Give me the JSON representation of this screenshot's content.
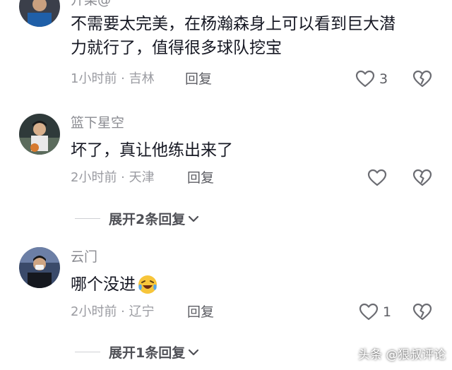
{
  "comments": [
    {
      "username": "开菜@",
      "text_lines": [
        "不需要太完美，在杨瀚森身上可以看到巨大潜",
        "力就行了，值得很多球队挖宝"
      ],
      "time": "1小时前 · 吉林",
      "reply_label": "回复",
      "like_count": "3"
    },
    {
      "username": "篮下星空",
      "text_lines": [
        "坏了，真让他练出来了"
      ],
      "time": "2小时前 · 天津",
      "reply_label": "回复",
      "like_count": ""
    },
    {
      "username": "云门",
      "text_lines": [
        "哪个没进"
      ],
      "emoji": "laughing-crying-emoji",
      "time": "2小时前 · 辽宁",
      "reply_label": "回复",
      "like_count": "1"
    }
  ],
  "expand_links": [
    "展开2条回复",
    "展开1条回复"
  ],
  "watermark": "头条 @狠叔评论",
  "colors": {
    "text": "#161823",
    "meta": "#9a9ba1",
    "username": "#8a8b91",
    "background": "#ffffff"
  }
}
